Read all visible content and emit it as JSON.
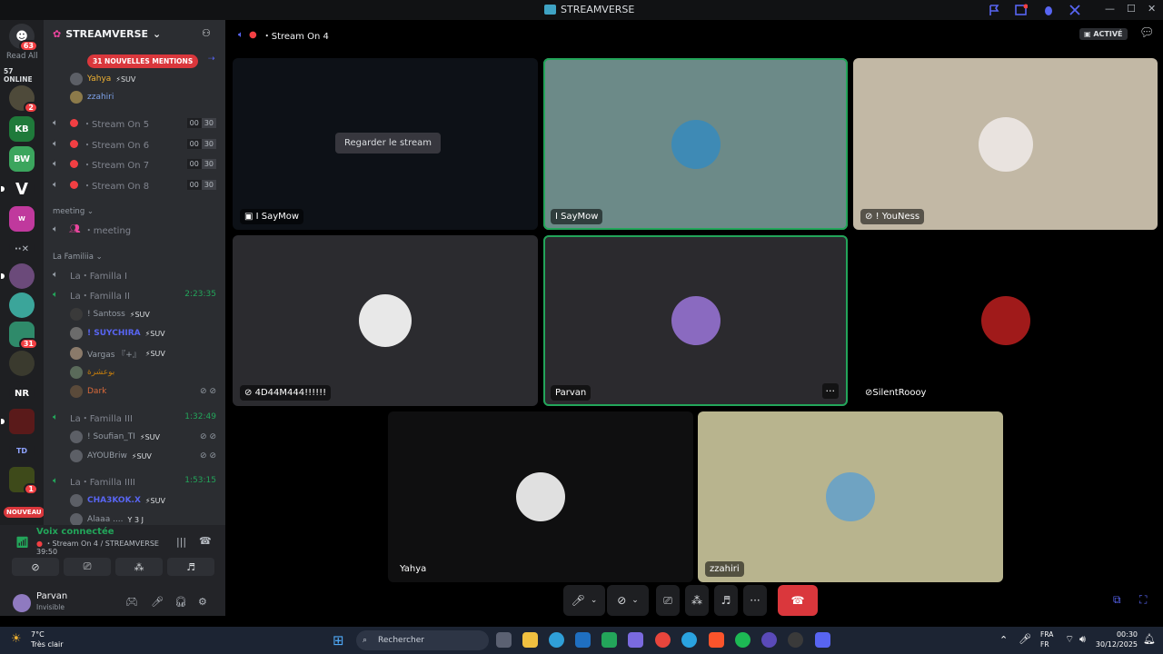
{
  "titlebar": {
    "title": "STREAMVERSE"
  },
  "rail": {
    "dm_badge": "63",
    "read_all": "Read All",
    "online": "57 ONLINE",
    "nr_label": "NR",
    "new_label": "NOUVEAU",
    "badges": {
      "a": "2",
      "b": "31",
      "c": "1"
    }
  },
  "sidebar": {
    "server_name": "STREAMVERSE",
    "mentions": "31 NOUVELLES MENTIONS",
    "top_members": [
      {
        "name": "Yahya",
        "tag": "SUV"
      },
      {
        "name": "zzahiri",
        "tag": ""
      }
    ],
    "channels": [
      {
        "label": "Stream On 5",
        "a": "00",
        "b": "30"
      },
      {
        "label": "Stream On 6",
        "a": "00",
        "b": "30"
      },
      {
        "label": "Stream On 7",
        "a": "00",
        "b": "30"
      },
      {
        "label": "Stream On 8",
        "a": "00",
        "b": "30"
      }
    ],
    "cat_meeting": "meeting",
    "meeting_channel": "meeting",
    "cat_familia": "La Familiia",
    "familia1": "La・Familla I",
    "familia2": "La・Familla II",
    "familia2_time": "2:23:35",
    "familia2_members": [
      {
        "name": "! Santoss",
        "tag": "SUV"
      },
      {
        "name": "! SUYCHIRA",
        "tag": "SUV"
      },
      {
        "name": "Vargas 『+』",
        "tag": "SUV"
      },
      {
        "name": "بوعشرة",
        "tag": ""
      },
      {
        "name": "Dark",
        "tag": ""
      }
    ],
    "familia3": "La・Familla III",
    "familia3_time": "1:32:49",
    "familia3_members": [
      {
        "name": "! Soufian_TI",
        "tag": "SUV"
      },
      {
        "name": "AYOUBriw",
        "tag": "SUV"
      }
    ],
    "familia4": "La・Familla IIII",
    "familia4_time": "1:53:15",
    "familia4_members": [
      {
        "name": "CHA3KOK.X",
        "tag": "SUV"
      },
      {
        "name": "Alaaa ....",
        "tag": "Y 3 J"
      }
    ]
  },
  "voice": {
    "status": "Voix connectée",
    "location": "Stream On 4 / STREAMVERSE",
    "elapsed": "39:50"
  },
  "user": {
    "name": "Parvan",
    "status": "Invisible"
  },
  "main": {
    "room": "Stream On 4",
    "activity": "ACTIVÉ",
    "watch_label": "Regarder le stream",
    "tiles": [
      {
        "name": "I SayMow",
        "kind": "stream"
      },
      {
        "name": "I SayMow",
        "kind": "user"
      },
      {
        "name": "! YouNess",
        "kind": "user"
      },
      {
        "name": "4D44M444!!!!!!",
        "kind": "user"
      },
      {
        "name": "Parvan",
        "kind": "user"
      },
      {
        "name": "SilentRoooy",
        "kind": "user"
      },
      {
        "name": "Yahya",
        "kind": "user"
      },
      {
        "name": "zzahiri",
        "kind": "user"
      }
    ]
  },
  "taskbar": {
    "temp": "7°C",
    "weather": "Très clair",
    "search": "Rechercher",
    "lang1": "FRA",
    "lang2": "FR",
    "time": "00:30",
    "date": "30/12/2025"
  },
  "colors": {
    "accent_green": "#23a55a",
    "danger": "#da373c",
    "blurple": "#5865f2"
  }
}
